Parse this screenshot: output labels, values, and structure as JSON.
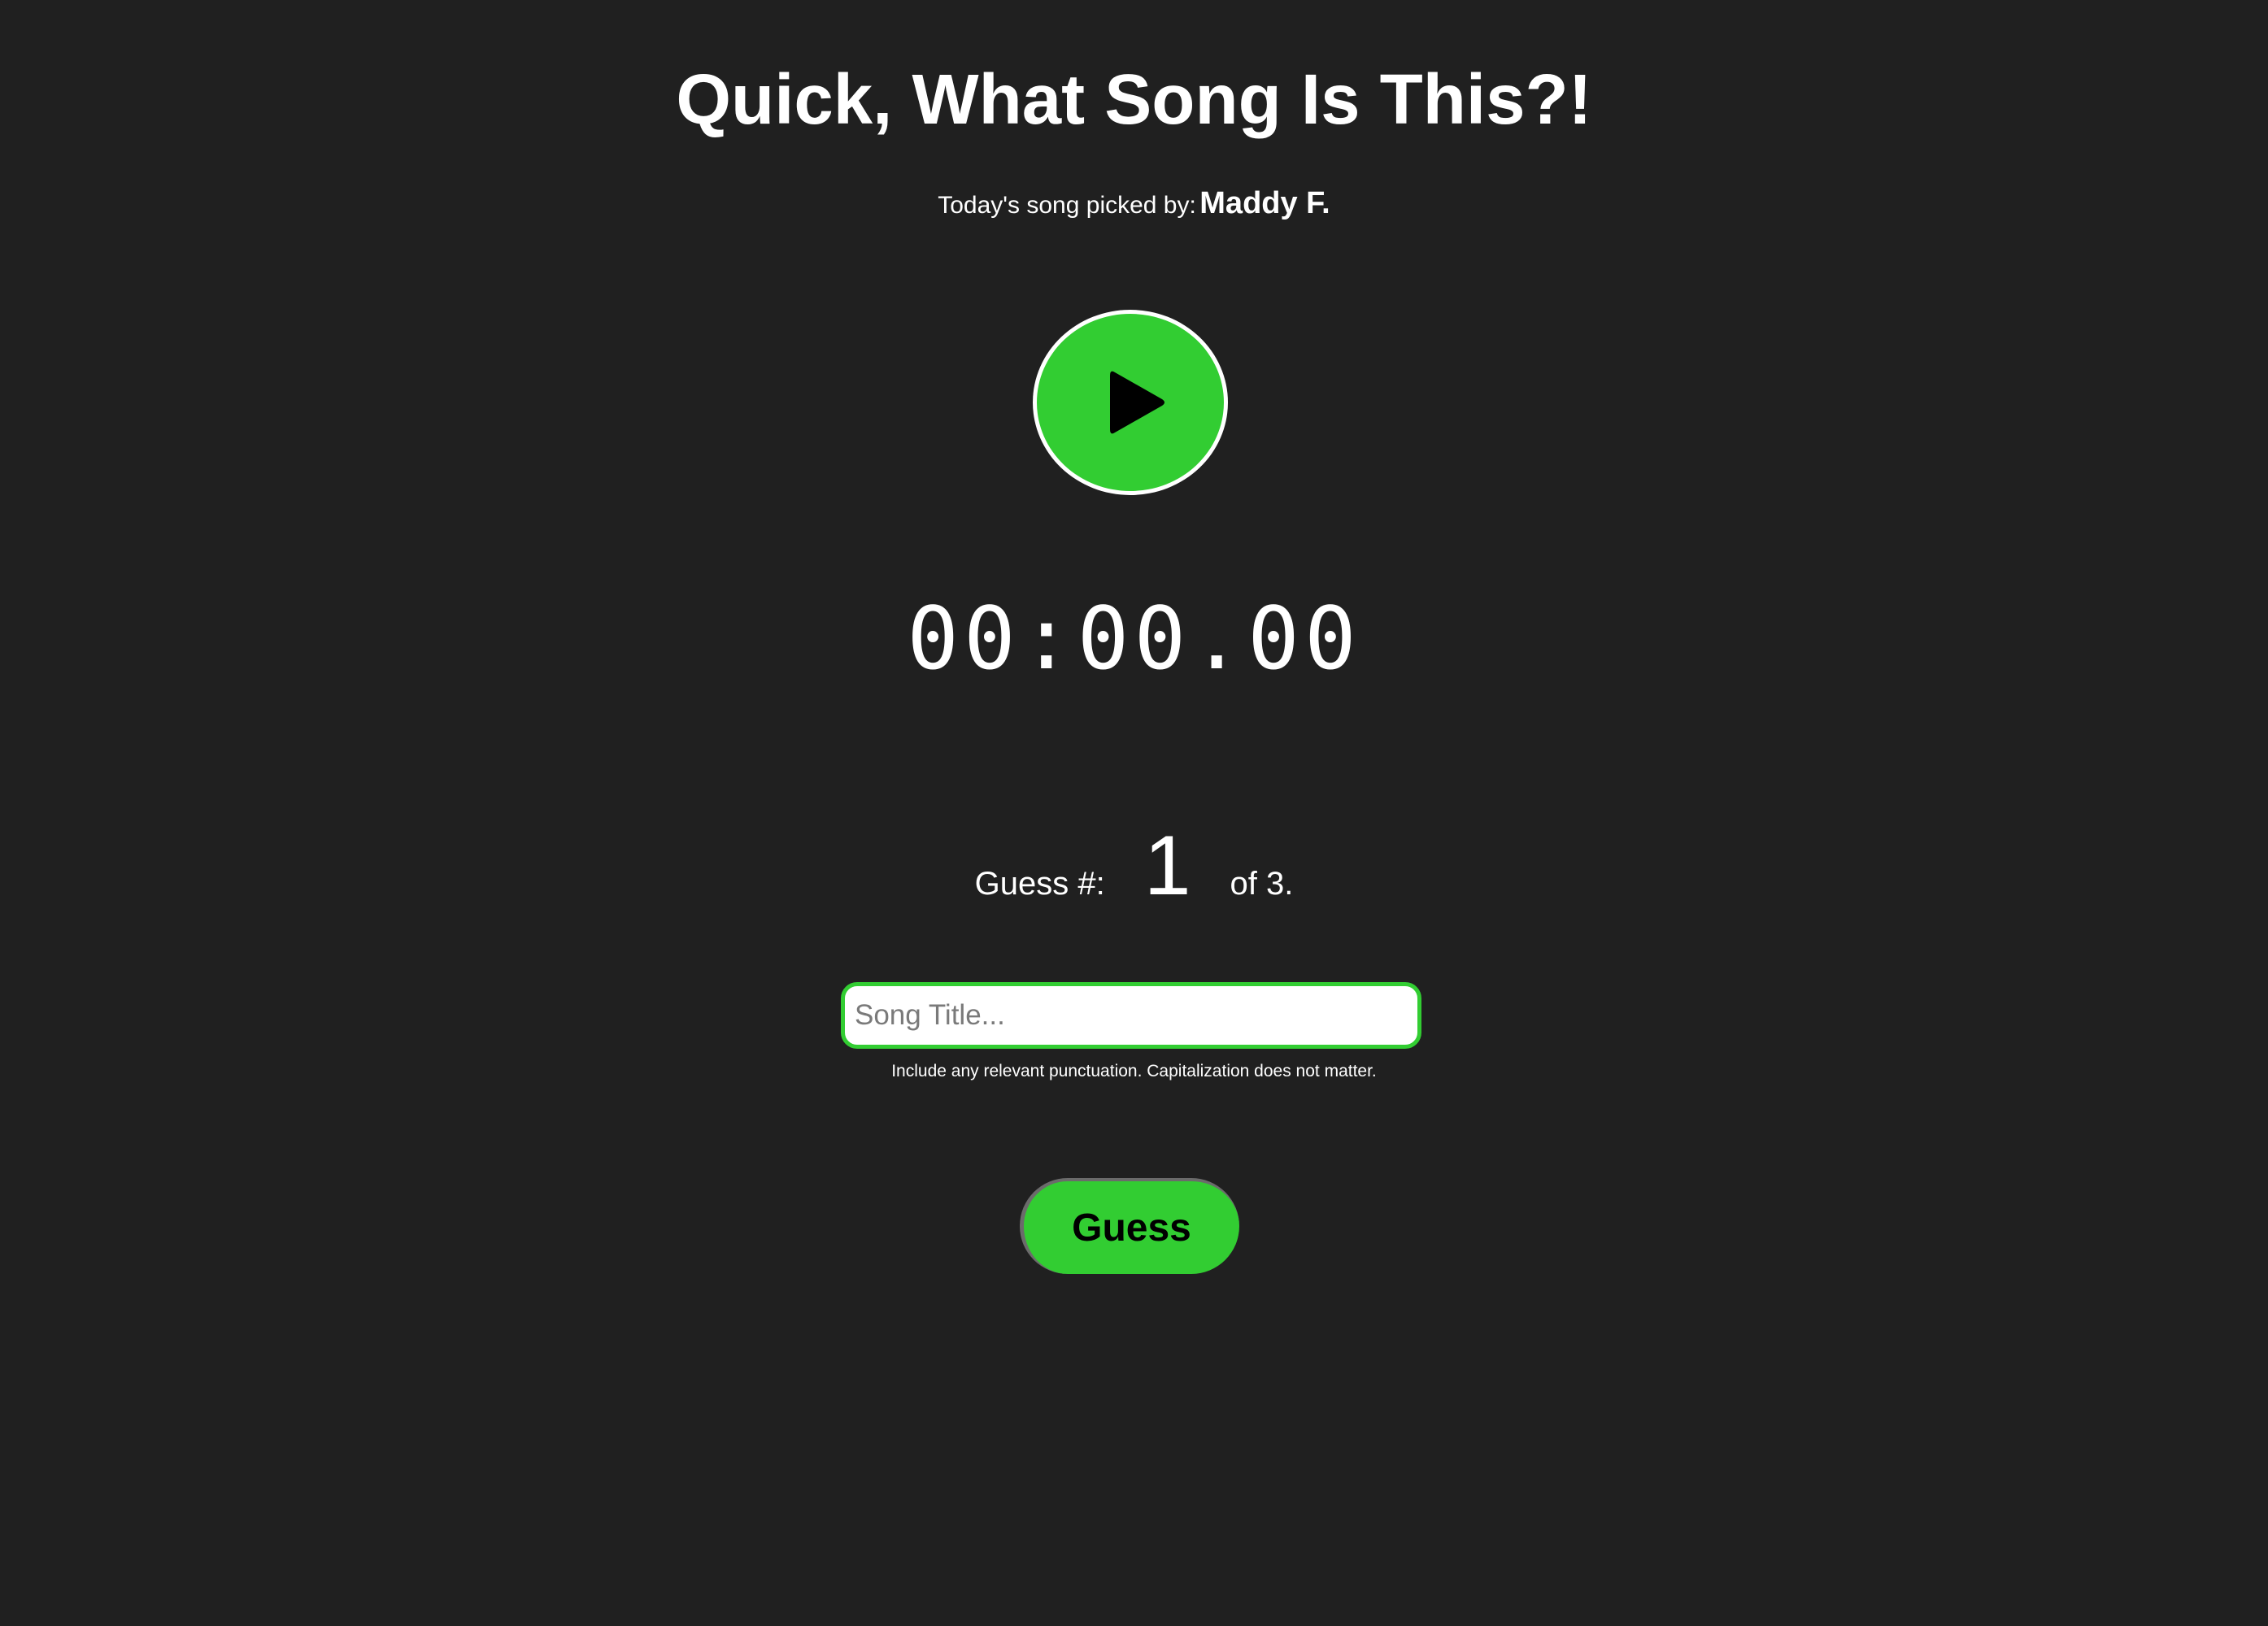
{
  "header": {
    "title": "Quick, What Song Is This?!"
  },
  "picker": {
    "label": "Today's song picked by:",
    "name": "Maddy F."
  },
  "player": {
    "play_icon": "play-icon",
    "timer": "00:00.00"
  },
  "guess": {
    "label": "Guess #:",
    "current": "1",
    "total_text": "of 3."
  },
  "form": {
    "placeholder": "Song Title...",
    "value": "",
    "hint": "Include any relevant punctuation. Capitalization does not matter.",
    "button_label": "Guess"
  },
  "colors": {
    "background": "#202020",
    "accent": "#32cd32",
    "text": "#ffffff"
  }
}
